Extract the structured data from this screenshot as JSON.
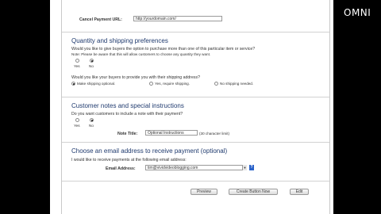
{
  "watermark": "OMNI",
  "cancel": {
    "label": "Cancel Payment URL:",
    "value": "http://yourdomain.com/"
  },
  "quantity": {
    "heading": "Quantity and shipping preferences",
    "q1_line1": "Would you like to give buyers the option to purchase more than one of this particular item or service?",
    "q1_line2": "Note: Please be aware that this will allow customers to choose any quantity they want.",
    "yes": "Yes",
    "no": "No",
    "q2": "Would you like your buyers to provide you with their shipping address?",
    "ship_optional": "Make shipping optional.",
    "ship_required": "Yes, require shipping.",
    "ship_none": "No shipping needed."
  },
  "notes": {
    "heading": "Customer notes and special instructions",
    "question": "Do you want customers to include a note with their payment?",
    "yes": "Yes",
    "no": "No",
    "title_label": "Note Title:",
    "title_value": "Optional Instructions",
    "limit": "(30 character limit)"
  },
  "email": {
    "heading": "Choose an email address to receive payment (optional)",
    "line": "I would like to receive payments at the following email address:",
    "label": "Email Address:",
    "value": "tim@vividvideoblogging.com"
  },
  "help_glyph": "?",
  "buttons": {
    "preview": "Preview",
    "create": "Create Button Now",
    "edit": "Edit"
  }
}
